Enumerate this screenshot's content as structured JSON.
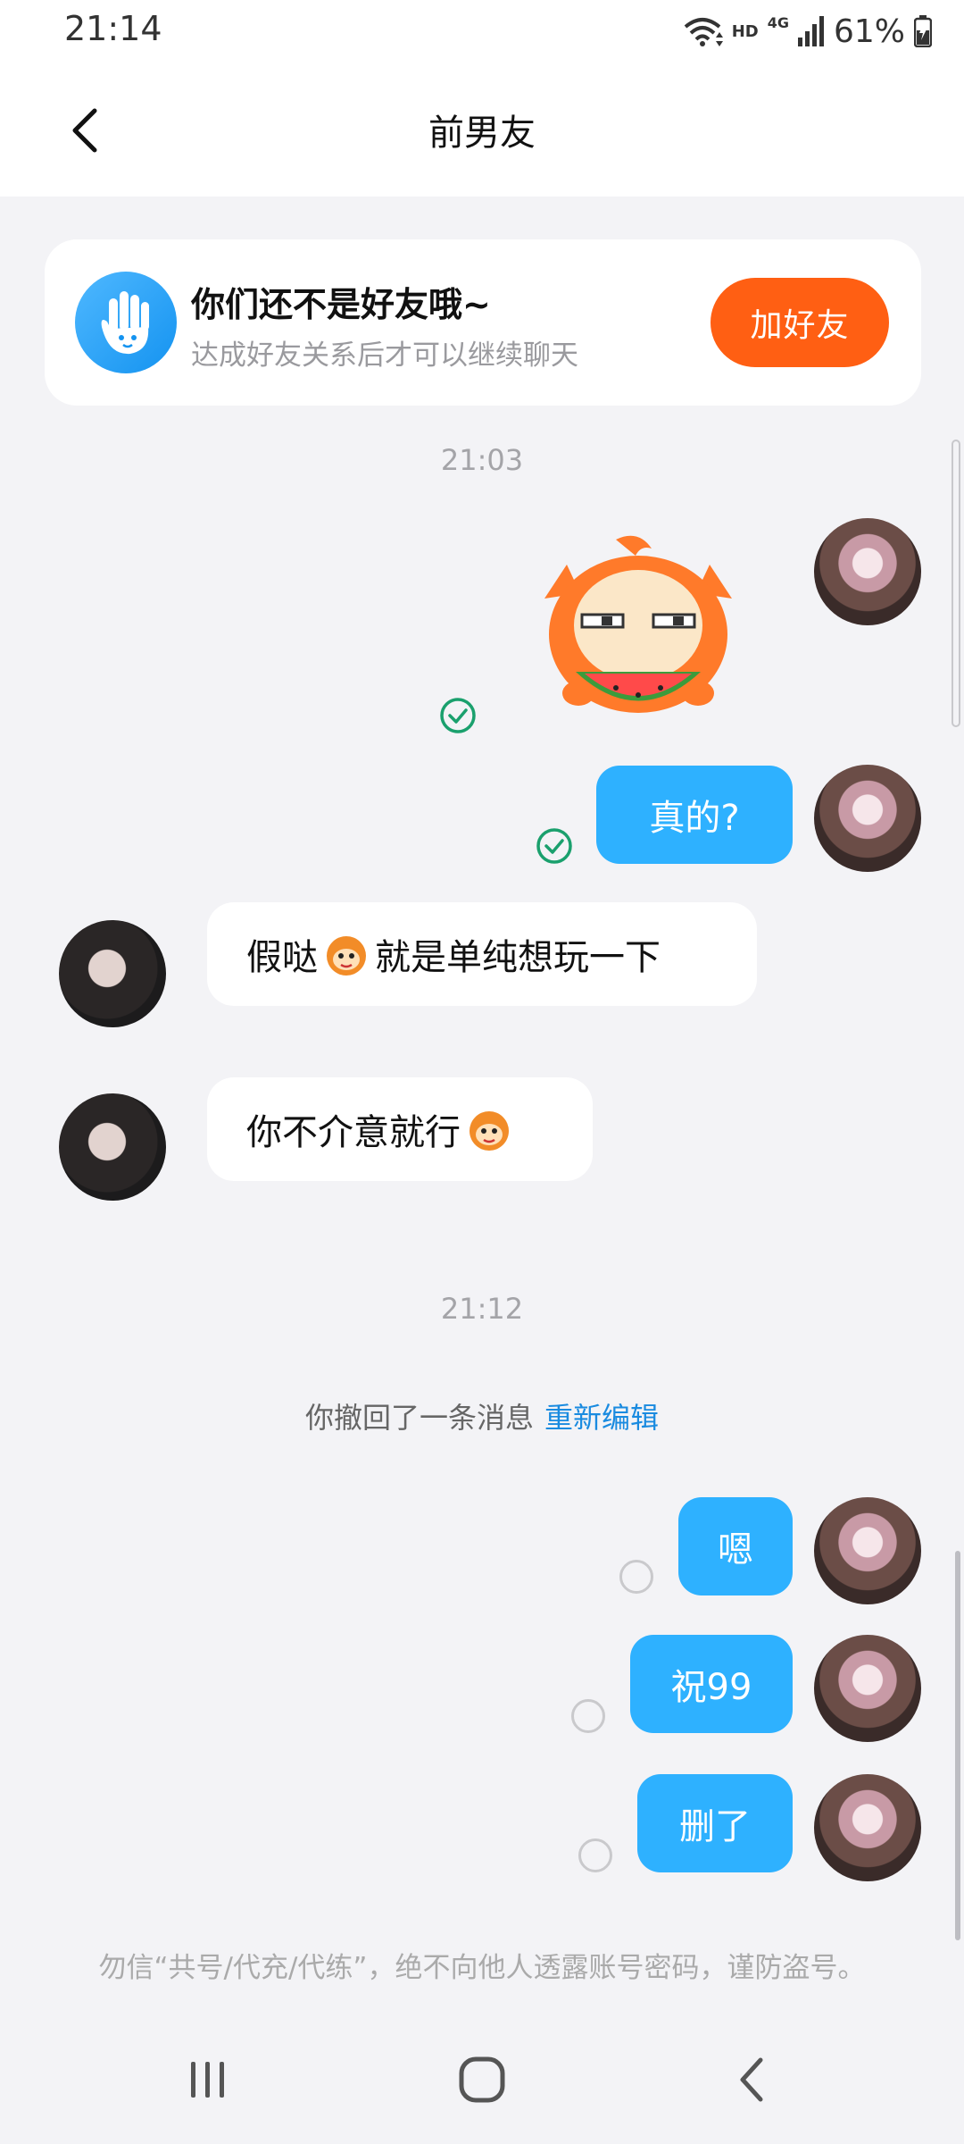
{
  "status_bar": {
    "time": "21:14",
    "hd": "HD",
    "network": "4G",
    "battery": "61%"
  },
  "header": {
    "title": "前男友",
    "back_icon": "chevron-left-icon"
  },
  "friend_card": {
    "title": "你们还不是好友哦~",
    "subtitle": "达成好友关系后才可以继续聊天",
    "button": "加好友",
    "icon": "hand-wave-icon",
    "accent": "#ff5f13"
  },
  "messages": {
    "timestamp_1": "21:03",
    "me_1": "真的?",
    "other_1_a": "假哒",
    "other_1_b": "就是单纯想玩一下",
    "other_2": "你不介意就行",
    "timestamp_2": "21:12",
    "recall_text": "你撤回了一条消息",
    "recall_link": "重新编辑",
    "me_2": "嗯",
    "me_3": "祝99",
    "me_4": "删了"
  },
  "footer_warning": "勿信“共号/代充/代练”，绝不向他人透露账号密码，谨防盗号。",
  "colors": {
    "bubble_me": "#2eb1ff",
    "sent_check": "#1aa06d",
    "link": "#1a8be0"
  }
}
